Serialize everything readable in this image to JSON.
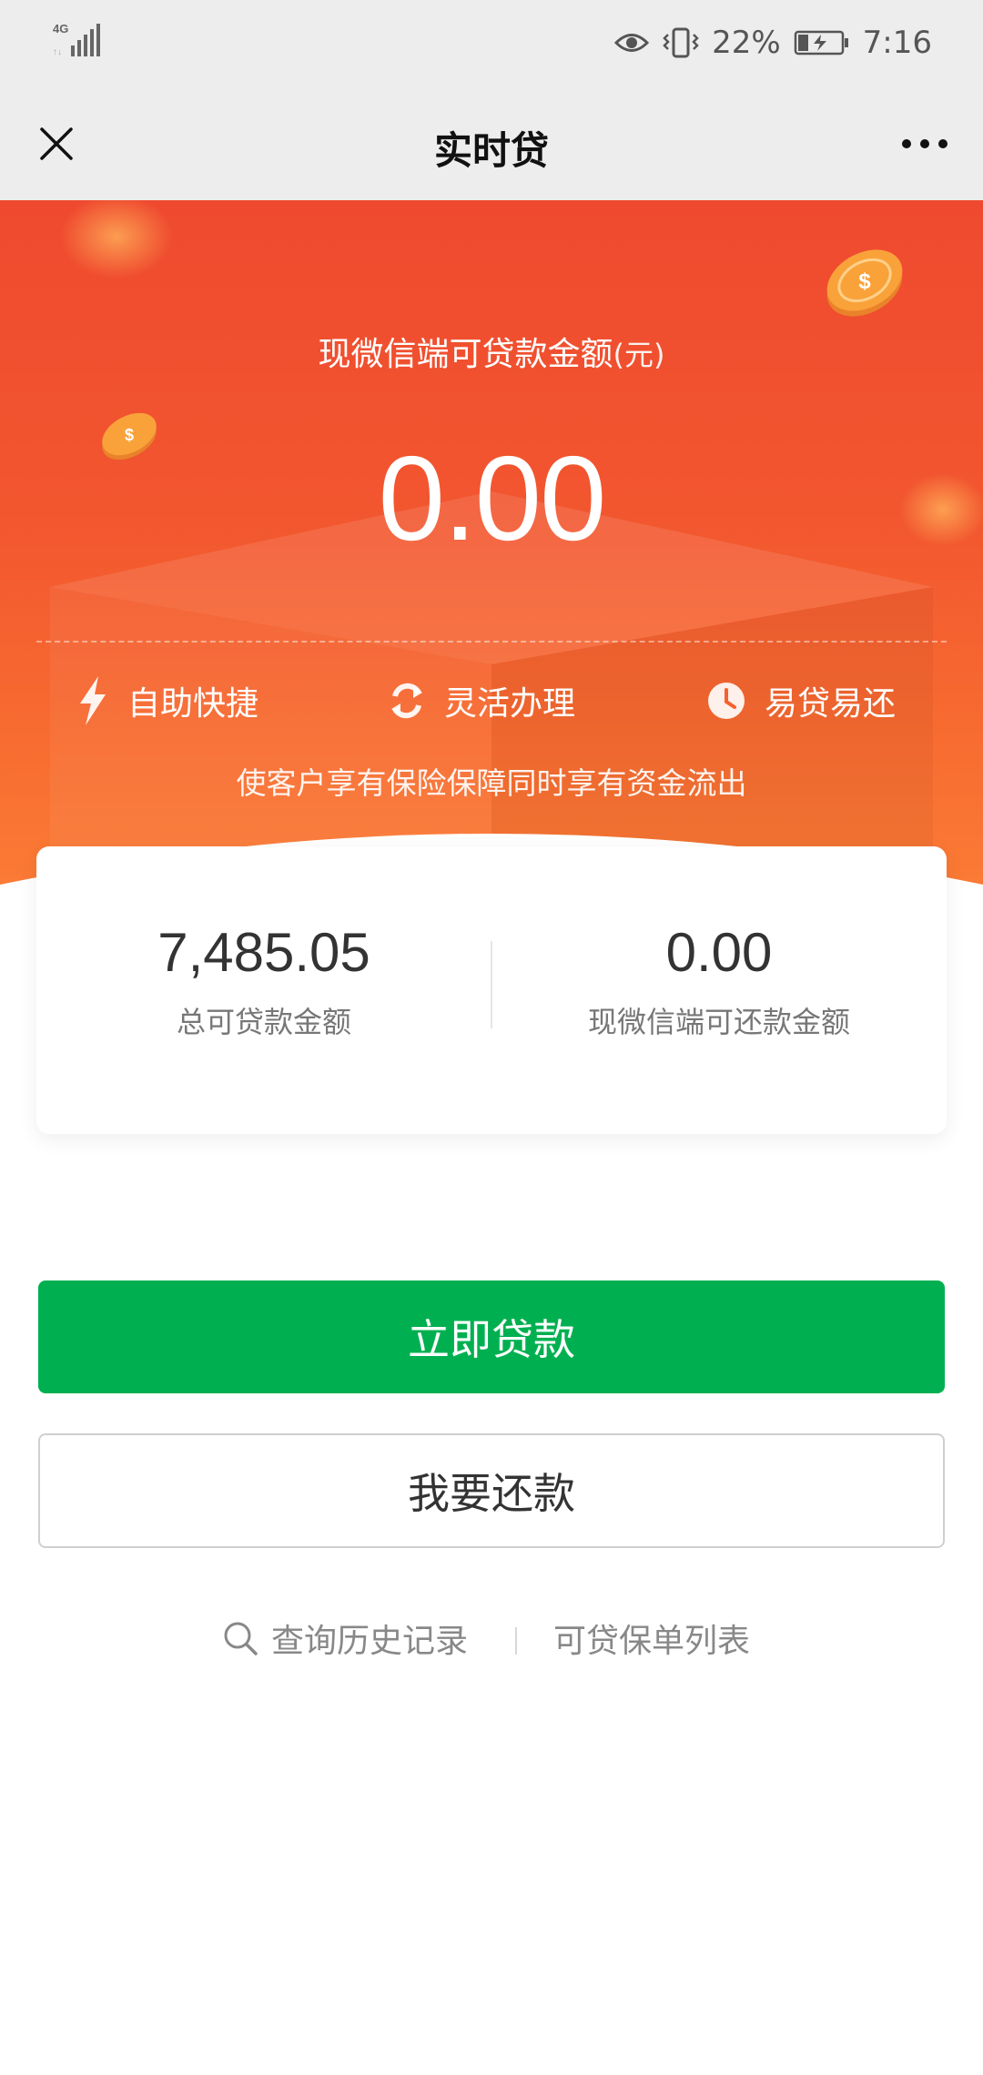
{
  "status_bar": {
    "network": "4G",
    "battery_percent": "22%",
    "time": "7:16",
    "icons": [
      "signal-icon",
      "eye-icon",
      "vibrate-icon",
      "battery-charging-icon"
    ]
  },
  "header": {
    "title": "实时贷",
    "close_icon": "close-icon",
    "more_icon": "more-icon"
  },
  "hero": {
    "label": "现微信端可贷款金额",
    "unit": "(元)",
    "amount": "0.00",
    "features": [
      {
        "icon": "lightning-icon",
        "label": "自助快捷"
      },
      {
        "icon": "refresh-icon",
        "label": "灵活办理"
      },
      {
        "icon": "clock-icon",
        "label": "易贷易还"
      }
    ],
    "description": "使客户享有保险保障同时享有资金流出"
  },
  "summary": {
    "total_loanable": {
      "value": "7,485.05",
      "label": "总可贷款金额"
    },
    "repayable": {
      "value": "0.00",
      "label": "现微信端可还款金额"
    }
  },
  "actions": {
    "borrow_label": "立即贷款",
    "repay_label": "我要还款"
  },
  "links": {
    "history_label": "查询历史记录",
    "policies_label": "可贷保单列表"
  },
  "colors": {
    "hero_top": "#ef4a2f",
    "hero_bottom": "#fb7b35",
    "primary_button": "#00b050",
    "coin": "#f9a23a"
  }
}
